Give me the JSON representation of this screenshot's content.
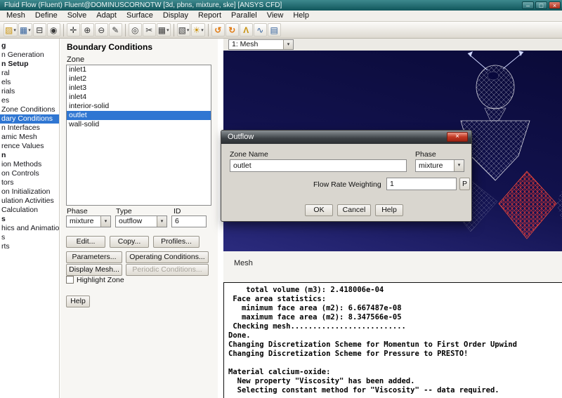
{
  "window": {
    "title": "Fluid Flow (Fluent) Fluent@DOMINUSCORNOTW [3d, pbns, mixture, ske] [ANSYS CFD]"
  },
  "ui": {
    "caret": "▾",
    "min_glyph": "–",
    "max_glyph": "□",
    "close_glyph": "×"
  },
  "menu": {
    "items": [
      "Mesh",
      "Define",
      "Solve",
      "Adapt",
      "Surface",
      "Display",
      "Report",
      "Parallel",
      "View",
      "Help"
    ]
  },
  "toolbar": {
    "caret": "▾",
    "icons": [
      {
        "name": "open-icon",
        "glyph": "▨"
      },
      {
        "name": "save-icon",
        "glyph": "▦"
      },
      {
        "name": "print-icon",
        "glyph": "⊟"
      },
      {
        "name": "snapshot-icon",
        "glyph": "◉"
      },
      {
        "name": "pan-rotate-icon",
        "glyph": "✛"
      },
      {
        "name": "zoom-in-icon",
        "glyph": "⊕"
      },
      {
        "name": "zoom-out-icon",
        "glyph": "⊖"
      },
      {
        "name": "pencil-icon",
        "glyph": "✎"
      },
      {
        "name": "probe-icon",
        "glyph": "◎"
      },
      {
        "name": "measure-icon",
        "glyph": "✂"
      },
      {
        "name": "surface-grid-icon",
        "glyph": "▦"
      },
      {
        "name": "shading-icon",
        "glyph": "▧"
      },
      {
        "name": "lights-icon",
        "glyph": "☀"
      },
      {
        "name": "initialize-icon",
        "glyph": "↺"
      },
      {
        "name": "iterate-icon",
        "glyph": "↻"
      },
      {
        "name": "lambda-icon",
        "glyph": "Λ"
      },
      {
        "name": "residuals-icon",
        "glyph": "∿"
      },
      {
        "name": "report-icon",
        "glyph": "▤"
      }
    ]
  },
  "sidebar": {
    "items": [
      "g",
      "n Generation",
      "n Setup",
      "ral",
      "els",
      "rials",
      "es",
      "Zone Conditions",
      "dary Conditions",
      "n Interfaces",
      "amic Mesh",
      "rence Values",
      "n",
      "ion Methods",
      "on Controls",
      "tors",
      "on Initialization",
      "ulation Activities",
      "Calculation",
      "s",
      "hics and Animations",
      "s",
      "rts"
    ]
  },
  "panel": {
    "title": "Boundary Conditions",
    "zone_label": "Zone",
    "zones": [
      "inlet1",
      "inlet2",
      "inlet3",
      "inlet4",
      "interior-solid",
      "outlet",
      "wall-solid"
    ],
    "selected_zone": "outlet",
    "phase_label": "Phase",
    "phase_value": "mixture",
    "type_label": "Type",
    "type_value": "outflow",
    "id_label": "ID",
    "id_value": "6",
    "edit": "Edit...",
    "copy": "Copy...",
    "profiles": "Profiles...",
    "parameters": "Parameters...",
    "operating": "Operating Conditions...",
    "display_mesh": "Display Mesh...",
    "periodic": "Periodic Conditions...",
    "highlight": "Highlight Zone",
    "help": "Help"
  },
  "graphics": {
    "view_selector": "1: Mesh",
    "caption": "Mesh"
  },
  "dialog": {
    "title": "Outflow",
    "zone_name_label": "Zone Name",
    "zone_name_value": "outlet",
    "phase_label": "Phase",
    "phase_value": "mixture",
    "flow_rate_label": "Flow Rate Weighting",
    "flow_rate_value": "1",
    "p_button": "P",
    "ok": "OK",
    "cancel": "Cancel",
    "help": "Help"
  },
  "console": {
    "lines": [
      "    total volume (m3): 2.418006e-04",
      " Face area statistics:",
      "   minimum face area (m2): 6.667487e-08",
      "   maximum face area (m2): 8.347566e-05",
      " Checking mesh..........................",
      "Done.",
      "Changing Discretization Scheme for Momentun to First Order Upwind",
      "Changing Discretization Scheme for Pressure to PRESTO!",
      "",
      "Material calcium-oxide:",
      "  New property \"Viscosity\" has been added.",
      "  Selecting constant method for \"Viscosity\" -- data required."
    ]
  }
}
